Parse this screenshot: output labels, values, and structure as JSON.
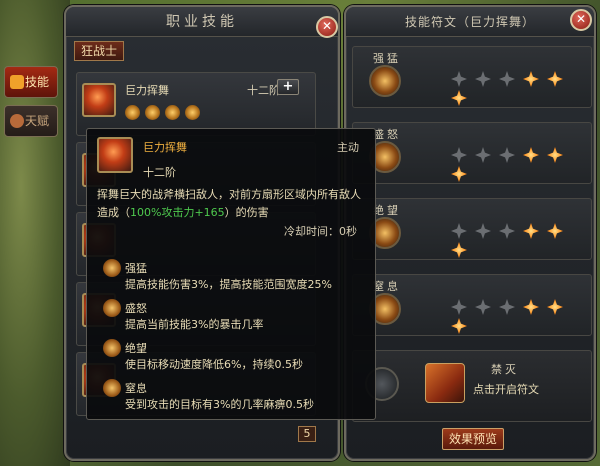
{
  "skills_panel": {
    "title": "职业技能",
    "class_tab": "狂战士",
    "side_tabs": [
      {
        "label": "技能"
      },
      {
        "label": "天赋"
      }
    ],
    "first_skill": {
      "name": "巨力挥舞",
      "level": "十二阶"
    },
    "page_number": "5"
  },
  "tooltip": {
    "name": "巨力挥舞",
    "type": "主动",
    "level": "十二阶",
    "desc_before": "挥舞巨大的战斧横扫敌人，对前方扇形区域内所有敌人造成（",
    "desc_green": "100%攻击力+165",
    "desc_after": "）的伤害",
    "cooldown_label": "冷却时间：",
    "cooldown_value": "0秒",
    "runes": [
      {
        "name": "强猛",
        "desc": "提高技能伤害3%，提高技能范围宽度25%"
      },
      {
        "name": "盛怒",
        "desc": "提高当前技能3%的暴击几率"
      },
      {
        "name": "绝望",
        "desc": "使目标移动速度降低6%，持续0.5秒"
      },
      {
        "name": "窒息",
        "desc": "受到攻击的目标有3%的几率麻痹0.5秒"
      }
    ]
  },
  "rune_panel": {
    "title": "技能符文（巨力挥舞）",
    "rows": [
      {
        "label": "强猛",
        "filled": 3
      },
      {
        "label": "盛怒",
        "filled": 3
      },
      {
        "label": "绝望",
        "filled": 3
      },
      {
        "label": "窒息",
        "filled": 3
      }
    ],
    "unlock_title": "禁灭",
    "unlock_text": "点击开启符文",
    "effect_button": "效果预览"
  },
  "colors": {
    "accent": "#f0b040",
    "highlight_green": "#4ec94e",
    "rune_filled": "#ff8c1a",
    "rune_empty": "#6b6e72"
  }
}
